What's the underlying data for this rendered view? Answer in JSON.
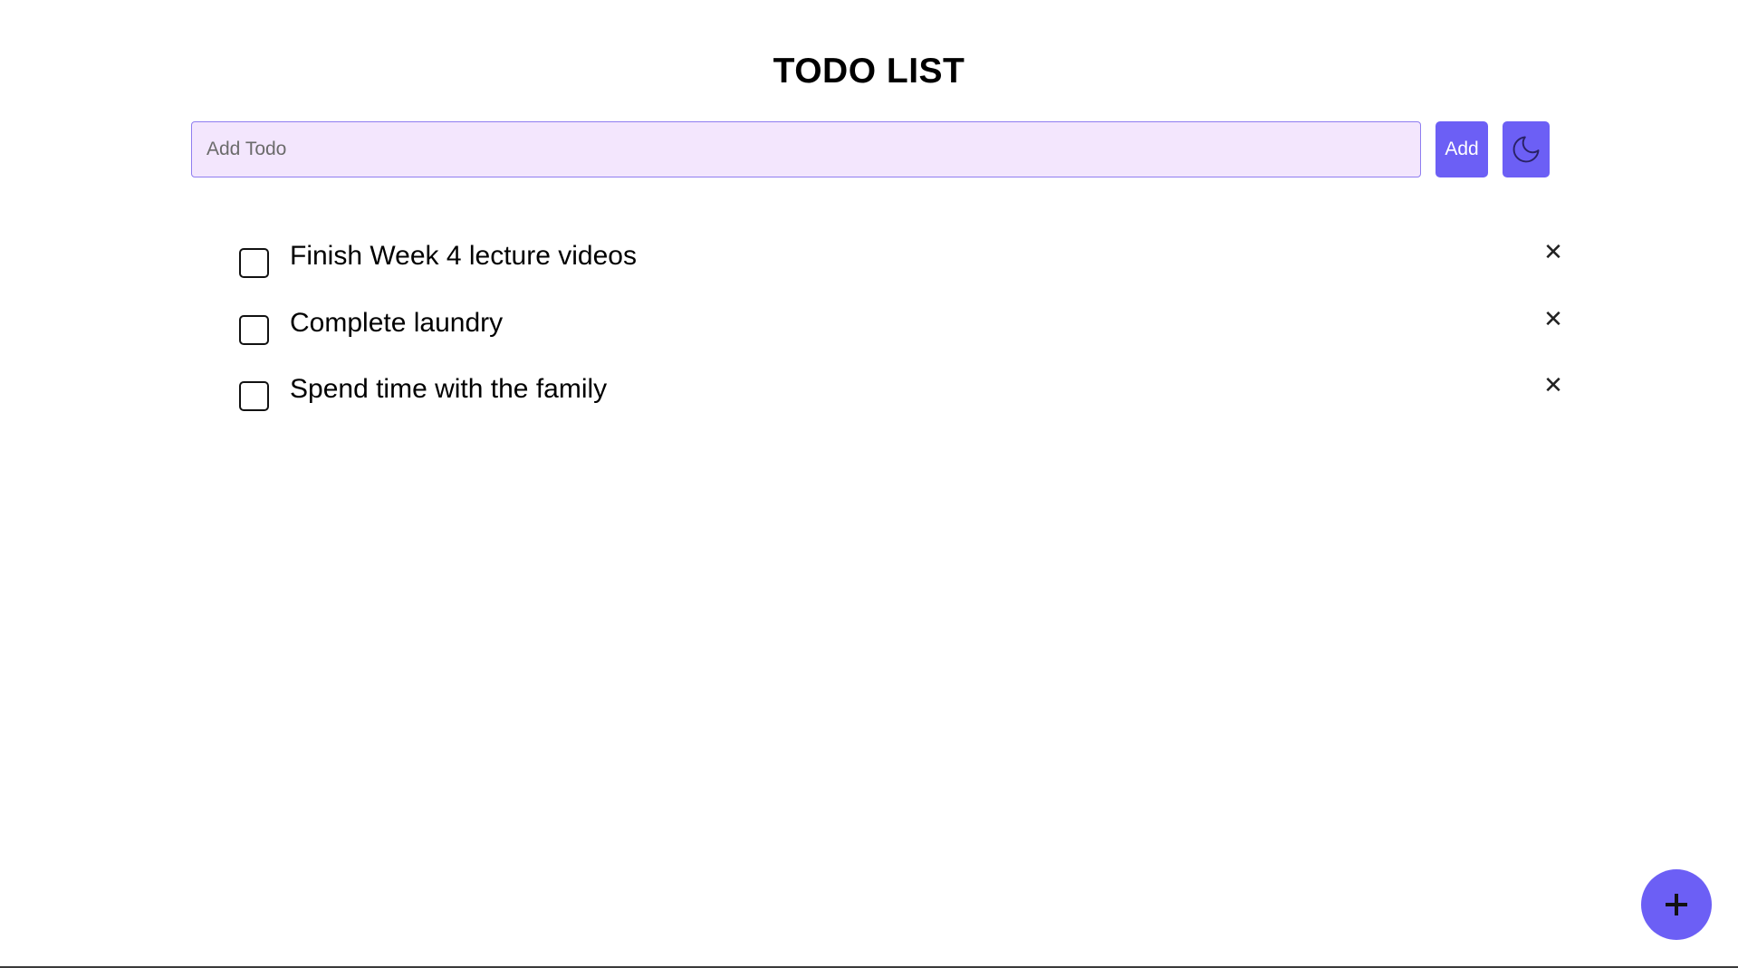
{
  "app": {
    "title": "TODO LIST"
  },
  "input": {
    "placeholder": "Add Todo",
    "value": ""
  },
  "buttons": {
    "add_label": "Add",
    "theme_icon": "moon-icon",
    "fab_icon": "plus-icon",
    "delete_icon": "close-icon"
  },
  "todos": [
    {
      "text": "Finish Week 4 lecture videos",
      "completed": false
    },
    {
      "text": "Complete laundry",
      "completed": false
    },
    {
      "text": "Spend time with the family",
      "completed": false
    }
  ],
  "colors": {
    "accent": "#6c5ff5",
    "input_background": "#f3e6fd",
    "input_border": "#8f7df0",
    "background": "#ffffff",
    "text": "#000000"
  }
}
